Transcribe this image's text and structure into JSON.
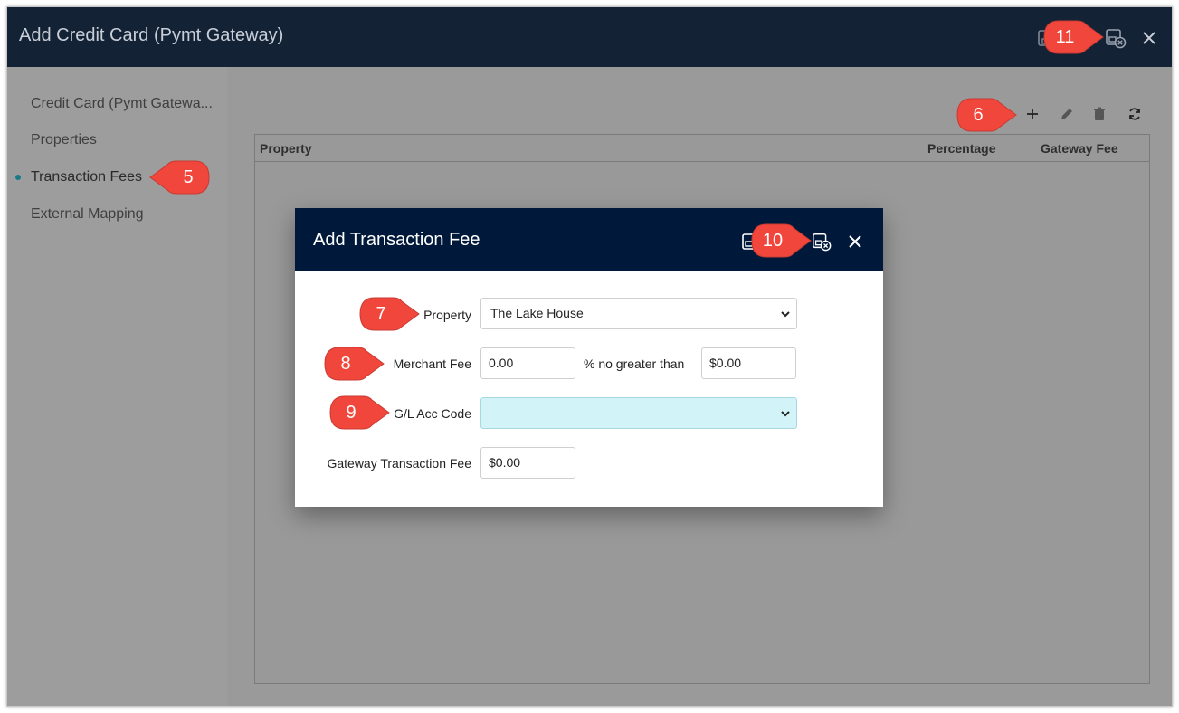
{
  "window": {
    "title": "Add Credit Card (Pymt Gateway)"
  },
  "sidebar": {
    "items": [
      {
        "label": "Credit Card (Pymt Gatewa..."
      },
      {
        "label": "Properties"
      },
      {
        "label": "Transaction Fees"
      },
      {
        "label": "External Mapping"
      }
    ]
  },
  "grid": {
    "columns": [
      "Property",
      "Percentage",
      "Gateway Fee"
    ]
  },
  "modal": {
    "title": "Add Transaction Fee",
    "property_label": "Property",
    "property_value": "The Lake House",
    "merchant_fee_label": "Merchant Fee",
    "merchant_fee_value": "0.00",
    "merchant_fee_suffix": "% no greater than",
    "merchant_fee_max": "$0.00",
    "gl_label": "G/L Acc Code",
    "gl_value": "",
    "gateway_fee_label": "Gateway Transaction Fee",
    "gateway_fee_value": "$0.00"
  },
  "callouts": {
    "c5": "5",
    "c6": "6",
    "c7": "7",
    "c8": "8",
    "c9": "9",
    "c10": "10",
    "c11": "11"
  },
  "colors": {
    "titlebar": "#142236",
    "modal_header": "#00193a",
    "callout": "#f0463c",
    "teal_field": "#d2f3f8"
  }
}
